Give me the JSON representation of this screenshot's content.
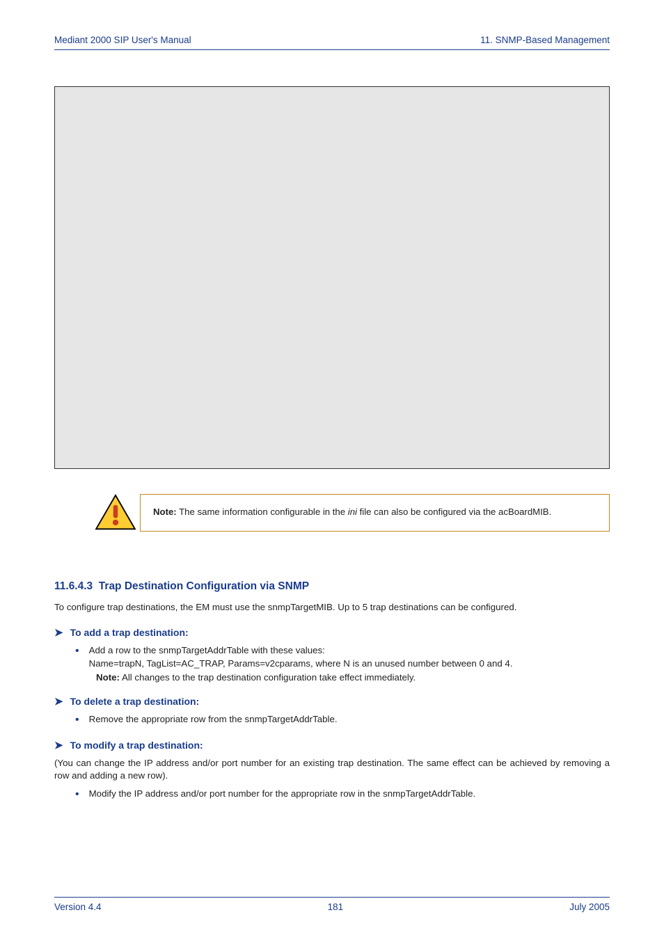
{
  "header": {
    "left": "Mediant 2000 SIP User's Manual",
    "right": "11. SNMP-Based Management"
  },
  "note": {
    "prefix": "Note:",
    "text_before_ini": " The same information configurable in the ",
    "ini": "ini",
    "text_after_ini": " file can also be configured via the acBoardMIB."
  },
  "section": {
    "number": "11.6.4.3",
    "title": "Trap Destination Configuration via SNMP"
  },
  "intro": "To configure trap destinations, the EM must use the snmpTargetMIB. Up to 5 trap destinations can be configured.",
  "arrows": {
    "a1": "To add a trap destination:",
    "a2": "To delete a trap destination:",
    "a3": "To modify a trap destination:"
  },
  "bullets": {
    "b1_line1": "Add a row to the snmpTargetAddrTable with these values:",
    "b1_line2": "Name=trapN, TagList=AC_TRAP, Params=v2cparams, where N is an unused number between 0 and 4.",
    "b1_note_label": "Note:",
    "b1_note_text": " All changes to the trap destination configuration take effect immediately.",
    "b2": "Remove the appropriate row from the snmpTargetAddrTable.",
    "b3": "Modify the IP address and/or port number for the appropriate row in the snmpTargetAddrTable."
  },
  "paren": "(You can change the IP address and/or port number for an existing trap destination. The same effect can be achieved by removing a row and adding a new row).",
  "footer": {
    "left": "Version 4.4",
    "center": "181",
    "right": "July 2005"
  }
}
